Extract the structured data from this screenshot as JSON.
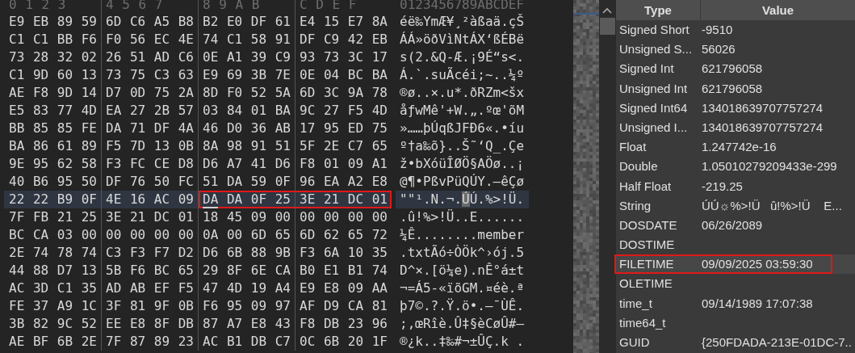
{
  "hex_view": {
    "column_header": "0 1 2 3 4 5 6 7 8 9 A B C D E F",
    "ascii_header": "0123456789ABCDEF",
    "rows": [
      {
        "groups": [
          {
            "hex": "E9 EB 89 59",
            "outlined": false,
            "cursor": false
          },
          {
            "hex": "6D C6 A5 B8",
            "outlined": false,
            "cursor": false
          },
          {
            "hex": "B2 E0 DF 61",
            "outlined": false,
            "cursor": false
          },
          {
            "hex": "E4 15 E7 8A",
            "outlined": false,
            "cursor": false
          }
        ],
        "ascii": "éë‰YmÆ¥¸²àßaä.çŠ",
        "selected": false
      },
      {
        "groups": [
          {
            "hex": "C1 C1 BB F6",
            "outlined": false,
            "cursor": false
          },
          {
            "hex": "F0 56 EC 4E",
            "outlined": false,
            "cursor": false
          },
          {
            "hex": "74 C1 58 91",
            "outlined": false,
            "cursor": false
          },
          {
            "hex": "DF C9 42 EB",
            "outlined": false,
            "cursor": false
          }
        ],
        "ascii": "ÁÁ»öðVìNtÁX‘ßÉBë",
        "selected": false
      },
      {
        "groups": [
          {
            "hex": "73 28 32 02",
            "outlined": false,
            "cursor": false
          },
          {
            "hex": "26 51 AD C6",
            "outlined": false,
            "cursor": false
          },
          {
            "hex": "0E A1 39 C9",
            "outlined": false,
            "cursor": false
          },
          {
            "hex": "93 73 3C 17",
            "outlined": false,
            "cursor": false
          }
        ],
        "ascii": "s(2.&Q-Æ.¡9É“s<.",
        "selected": false
      },
      {
        "groups": [
          {
            "hex": "C1 9D 60 13",
            "outlined": false,
            "cursor": false
          },
          {
            "hex": "73 75 C3 63",
            "outlined": false,
            "cursor": false
          },
          {
            "hex": "E9 69 3B 7E",
            "outlined": false,
            "cursor": false
          },
          {
            "hex": "0E 04 BC BA",
            "outlined": false,
            "cursor": false
          }
        ],
        "ascii": "Á.`.suÃcéi;~..¼º",
        "selected": false
      },
      {
        "groups": [
          {
            "hex": "AE F8 9D 14",
            "outlined": false,
            "cursor": false
          },
          {
            "hex": "D7 0D 75 2A",
            "outlined": false,
            "cursor": false
          },
          {
            "hex": "8D F0 52 5A",
            "outlined": false,
            "cursor": false
          },
          {
            "hex": "6D 3C 9A 78",
            "outlined": false,
            "cursor": false
          }
        ],
        "ascii": "®ø..×.u*.ðRZm<šx",
        "selected": false
      },
      {
        "groups": [
          {
            "hex": "E5 83 77 4D",
            "outlined": false,
            "cursor": false
          },
          {
            "hex": "EA 27 2B 57",
            "outlined": false,
            "cursor": false
          },
          {
            "hex": "03 84 01 BA",
            "outlined": false,
            "cursor": false
          },
          {
            "hex": "9C 27 F5 4D",
            "outlined": false,
            "cursor": false
          }
        ],
        "ascii": "åƒwMê'+W.„.ºœ'õM",
        "selected": false
      },
      {
        "groups": [
          {
            "hex": "BB 85 85 FE",
            "outlined": false,
            "cursor": false
          },
          {
            "hex": "DA 71 DF 4A",
            "outlined": false,
            "cursor": false
          },
          {
            "hex": "46 D0 36 AB",
            "outlined": false,
            "cursor": false
          },
          {
            "hex": "17 95 ED 75",
            "outlined": false,
            "cursor": false
          }
        ],
        "ascii": "»……þÚqßJFÐ6«.•íu",
        "selected": false
      },
      {
        "groups": [
          {
            "hex": "BA 86 61 89",
            "outlined": false,
            "cursor": false
          },
          {
            "hex": "F5 7D 13 0B",
            "outlined": false,
            "cursor": false
          },
          {
            "hex": "8A 98 91 51",
            "outlined": false,
            "cursor": false
          },
          {
            "hex": "5F 2E C7 65",
            "outlined": false,
            "cursor": false
          }
        ],
        "ascii": "º†a‰õ}..Š˜‘Q_.Çe",
        "selected": false
      },
      {
        "groups": [
          {
            "hex": "9E 95 62 58",
            "outlined": false,
            "cursor": false
          },
          {
            "hex": "F3 FC CE D8",
            "outlined": false,
            "cursor": false
          },
          {
            "hex": "D6 A7 41 D6",
            "outlined": false,
            "cursor": false
          },
          {
            "hex": "F8 01 09 A1",
            "outlined": false,
            "cursor": false
          }
        ],
        "ascii": "ž•bXóüÎØÖ§AÖø..¡",
        "selected": false
      },
      {
        "groups": [
          {
            "hex": "40 B6 95 50",
            "outlined": false,
            "cursor": false
          },
          {
            "hex": "DF 76 50 FC",
            "outlined": false,
            "cursor": false
          },
          {
            "hex": "51 DA 59 0F",
            "outlined": false,
            "cursor": false
          },
          {
            "hex": "96 EA A2 E8",
            "outlined": false,
            "cursor": false
          }
        ],
        "ascii": "@¶•PßvPüQÚY.–êÇø",
        "selected": false
      },
      {
        "groups": [
          {
            "hex": "22 22 B9 0F",
            "outlined": false,
            "cursor": false
          },
          {
            "hex": "4E 16 AC 09",
            "outlined": false,
            "cursor": false
          },
          {
            "hex": "DA DA 0F 25",
            "outlined": true,
            "cursor": true
          },
          {
            "hex": "3E 21 DC 01",
            "outlined": true,
            "cursor": false
          }
        ],
        "ascii": "\"\"¹.N.¬.ÚÚ.%>!Ü.",
        "selected": true
      },
      {
        "groups": [
          {
            "hex": "7F FB 21 25",
            "outlined": false,
            "cursor": false
          },
          {
            "hex": "3E 21 DC 01",
            "outlined": false,
            "cursor": false
          },
          {
            "hex": "18 45 09 00",
            "outlined": false,
            "cursor": false
          },
          {
            "hex": "00 00 00 00",
            "outlined": false,
            "cursor": false
          }
        ],
        "ascii": ".û!%>!Ü..E......",
        "selected": false
      },
      {
        "groups": [
          {
            "hex": "BC CA 03 00",
            "outlined": false,
            "cursor": false
          },
          {
            "hex": "00 00 00 00",
            "outlined": false,
            "cursor": false
          },
          {
            "hex": "0A 00 6D 65",
            "outlined": false,
            "cursor": false
          },
          {
            "hex": "6D 62 65 72",
            "outlined": false,
            "cursor": false
          }
        ],
        "ascii": "¼Ê........member",
        "selected": false
      },
      {
        "groups": [
          {
            "hex": "2E 74 78 74",
            "outlined": false,
            "cursor": false
          },
          {
            "hex": "C3 F3 F7 D2",
            "outlined": false,
            "cursor": false
          },
          {
            "hex": "D6 6B 88 9B",
            "outlined": false,
            "cursor": false
          },
          {
            "hex": "F3 6A 10 35",
            "outlined": false,
            "cursor": false
          }
        ],
        "ascii": ".txtÃó÷ÒÖk^›ój.5",
        "selected": false
      },
      {
        "groups": [
          {
            "hex": "44 88 D7 13",
            "outlined": false,
            "cursor": false
          },
          {
            "hex": "5B F6 BC 65",
            "outlined": false,
            "cursor": false
          },
          {
            "hex": "29 8F 6E CA",
            "outlined": false,
            "cursor": false
          },
          {
            "hex": "B0 E1 B1 74",
            "outlined": false,
            "cursor": false
          }
        ],
        "ascii": "D^×.[ö¼e).nÊ°á±t",
        "selected": false
      },
      {
        "groups": [
          {
            "hex": "AC 3D C1 35",
            "outlined": false,
            "cursor": false
          },
          {
            "hex": "AD AB EF F5",
            "outlined": false,
            "cursor": false
          },
          {
            "hex": "47 4D 19 A4",
            "outlined": false,
            "cursor": false
          },
          {
            "hex": "E9 E8 09 AA",
            "outlined": false,
            "cursor": false
          }
        ],
        "ascii": "¬=Á5-«ïõGM.¤éè.ª",
        "selected": false
      },
      {
        "groups": [
          {
            "hex": "FE 37 A9 1C",
            "outlined": false,
            "cursor": false
          },
          {
            "hex": "3F 81 9F 0B",
            "outlined": false,
            "cursor": false
          },
          {
            "hex": "F6 95 09 97",
            "outlined": false,
            "cursor": false
          },
          {
            "hex": "AF D9 CA 81",
            "outlined": false,
            "cursor": false
          }
        ],
        "ascii": "þ7©.?.Ÿ.ö•.—¯ÙÊ.",
        "selected": false
      },
      {
        "groups": [
          {
            "hex": "3B 82 9C 52",
            "outlined": false,
            "cursor": false
          },
          {
            "hex": "EE E8 8F DB",
            "outlined": false,
            "cursor": false
          },
          {
            "hex": "87 A7 E8 43",
            "outlined": false,
            "cursor": false
          },
          {
            "hex": "F8 DB 23 96",
            "outlined": false,
            "cursor": false
          }
        ],
        "ascii": ";‚œRîè.Û‡§èCøÛ#–",
        "selected": false
      },
      {
        "groups": [
          {
            "hex": "AE BF 6B 2E",
            "outlined": false,
            "cursor": false
          },
          {
            "hex": "7F 87 89 23",
            "outlined": false,
            "cursor": false
          },
          {
            "hex": "AC B1 DB C7",
            "outlined": false,
            "cursor": false
          },
          {
            "hex": "0C 6B 20 1F",
            "outlined": false,
            "cursor": false
          }
        ],
        "ascii": "®¿k..‡‰#¬±ÛÇ.k .",
        "selected": false
      }
    ]
  },
  "inspector": {
    "columns": [
      "Type",
      "Value"
    ],
    "rows": [
      {
        "type": "Signed Short",
        "value": "-9510",
        "selected": false,
        "outlined": false
      },
      {
        "type": "Unsigned S...",
        "value": "56026",
        "selected": false,
        "outlined": false
      },
      {
        "type": "Signed Int",
        "value": "621796058",
        "selected": false,
        "outlined": false
      },
      {
        "type": "Unsigned Int",
        "value": "621796058",
        "selected": false,
        "outlined": false
      },
      {
        "type": "Signed Int64",
        "value": "134018639707757274",
        "selected": false,
        "outlined": false
      },
      {
        "type": "Unsigned I...",
        "value": "134018639707757274",
        "selected": false,
        "outlined": false
      },
      {
        "type": "Float",
        "value": "1.247742e-16",
        "selected": false,
        "outlined": false
      },
      {
        "type": "Double",
        "value": "1.05010279209433e-299",
        "selected": false,
        "outlined": false
      },
      {
        "type": "Half Float",
        "value": "-219.25",
        "selected": false,
        "outlined": false
      },
      {
        "type": "String",
        "value": "ÚÚ☼%>!Ü   û!%>!Ü    E...",
        "selected": false,
        "outlined": false
      },
      {
        "type": "DOSDATE",
        "value": "06/26/2089",
        "selected": false,
        "outlined": false
      },
      {
        "type": "DOSTIME",
        "selected": false,
        "outlined": false
      },
      {
        "type": "FILETIME",
        "value": "09/09/2025 03:59:30",
        "selected": true,
        "outlined": true
      },
      {
        "type": "OLETIME",
        "selected": false,
        "outlined": false
      },
      {
        "type": "time_t",
        "value": "09/14/1989 17:07:38",
        "selected": false,
        "outlined": false
      },
      {
        "type": "time64_t",
        "selected": false,
        "outlined": false
      },
      {
        "type": "GUID",
        "value": "{250FDADA-213E-01DC-7..",
        "selected": false,
        "outlined": false
      }
    ]
  }
}
